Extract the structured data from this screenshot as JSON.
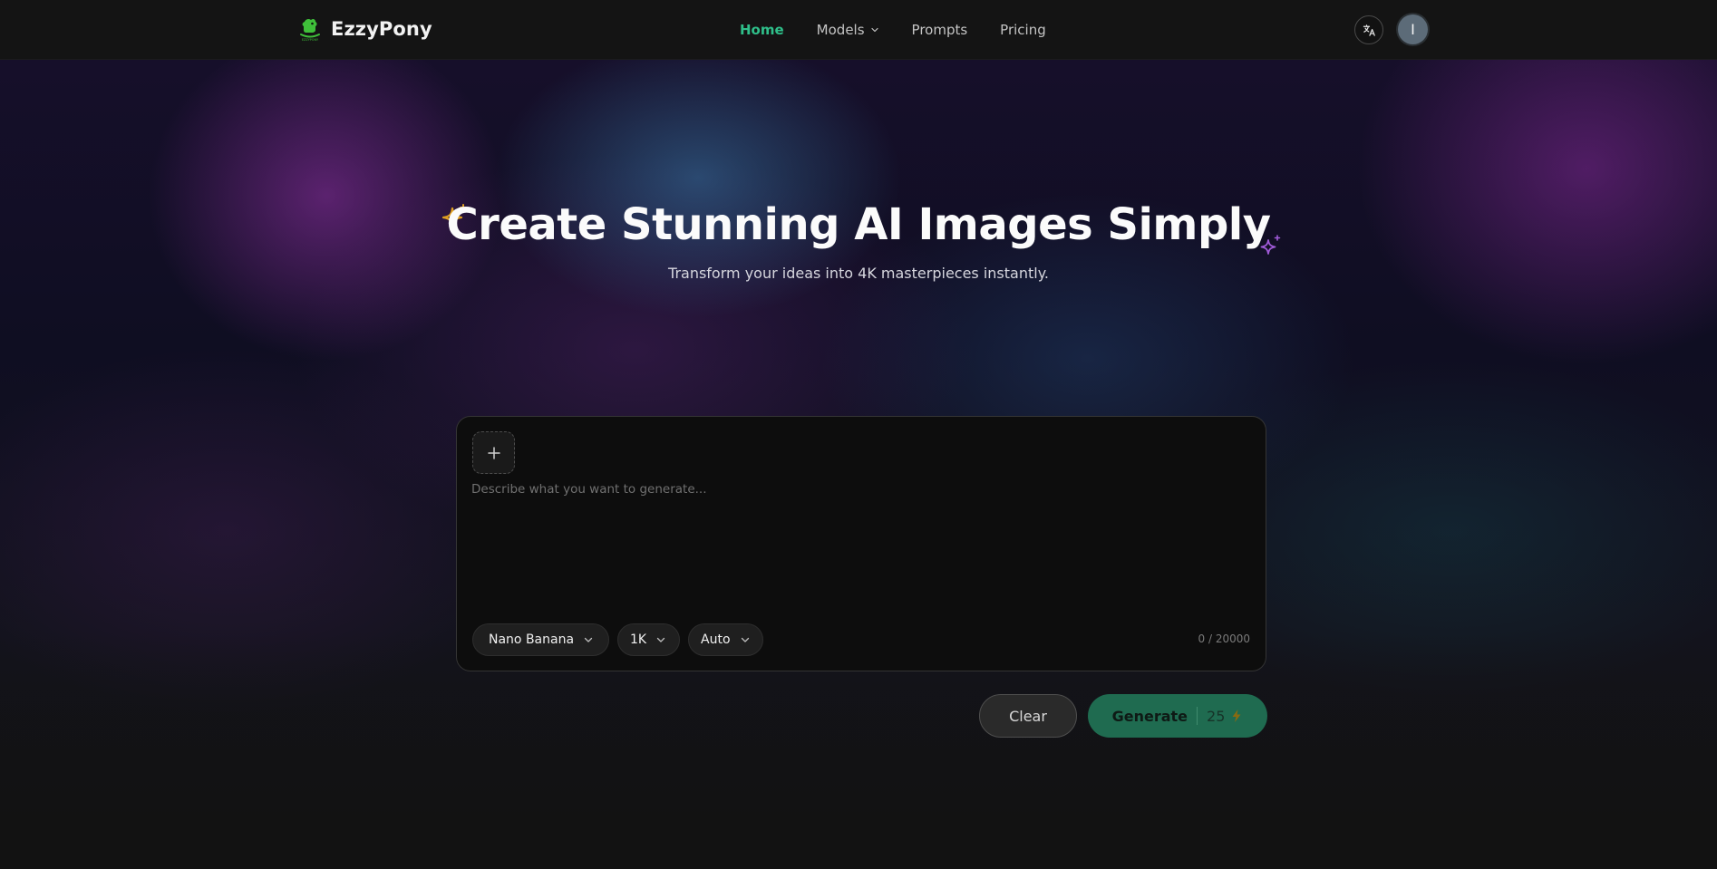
{
  "brand": {
    "name": "EzzyPony",
    "icon": "rocking-horse-logo-icon"
  },
  "nav": {
    "home": "Home",
    "models": "Models",
    "prompts": "Prompts",
    "pricing": "Pricing",
    "active": "Home"
  },
  "header": {
    "language_icon": "translate-icon",
    "avatar_initial": "I"
  },
  "hero": {
    "title": "Create Stunning AI Images Simply",
    "subtitle": "Transform your ideas into 4K masterpieces instantly."
  },
  "prompt": {
    "placeholder": "Describe what you want to generate...",
    "value": "",
    "upload_icon": "plus-icon",
    "char_count": "0 / 20000"
  },
  "options": {
    "model": "Nano Banana",
    "resolution": "1K",
    "aspect_ratio": "Auto"
  },
  "actions": {
    "clear": "Clear",
    "generate": "Generate",
    "cost": "25",
    "cost_icon": "bolt-icon"
  },
  "colors": {
    "accent": "#2fbf8a",
    "generate_bg": "#1f6b50",
    "spark_left": "#e0a020",
    "spark_right": "#a05ad8",
    "bolt": "#8a6a10"
  }
}
